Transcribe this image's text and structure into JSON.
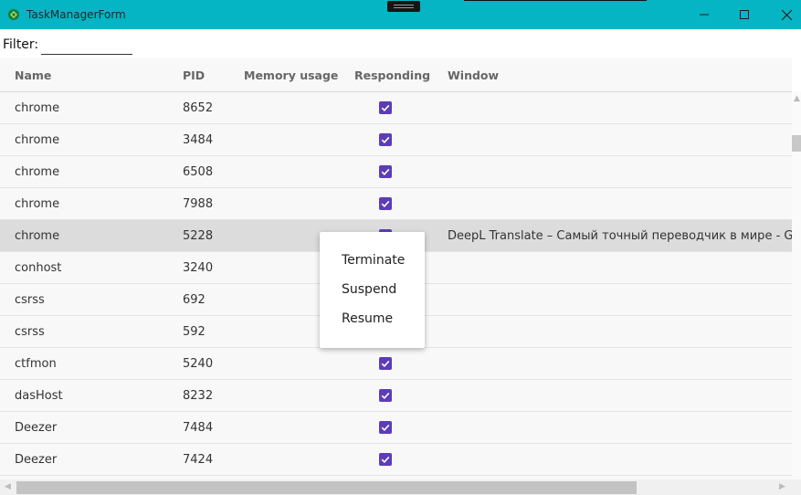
{
  "window": {
    "title": "TaskManagerForm",
    "accent": "#05b5c3",
    "icons": {
      "app": "app-icon",
      "minimize": "minimize-icon",
      "maximize": "maximize-icon",
      "close": "close-icon"
    }
  },
  "filter": {
    "label": "Filter:",
    "value": ""
  },
  "table": {
    "columns": [
      "Name",
      "PID",
      "Memory usage",
      "Responding",
      "Window"
    ],
    "rows": [
      {
        "name": "chrome",
        "pid": "8652",
        "memory": "",
        "responding": true,
        "window": ""
      },
      {
        "name": "chrome",
        "pid": "3484",
        "memory": "",
        "responding": true,
        "window": ""
      },
      {
        "name": "chrome",
        "pid": "6508",
        "memory": "",
        "responding": true,
        "window": ""
      },
      {
        "name": "chrome",
        "pid": "7988",
        "memory": "",
        "responding": true,
        "window": ""
      },
      {
        "name": "chrome",
        "pid": "5228",
        "memory": "",
        "responding": true,
        "window": "DeepL Translate – Самый точный переводчик в мире - Google C",
        "selected": true
      },
      {
        "name": "conhost",
        "pid": "3240",
        "memory": "",
        "responding": true,
        "window": ""
      },
      {
        "name": "csrss",
        "pid": "692",
        "memory": "",
        "responding": true,
        "window": ""
      },
      {
        "name": "csrss",
        "pid": "592",
        "memory": "",
        "responding": true,
        "window": ""
      },
      {
        "name": "ctfmon",
        "pid": "5240",
        "memory": "",
        "responding": true,
        "window": ""
      },
      {
        "name": "dasHost",
        "pid": "8232",
        "memory": "",
        "responding": true,
        "window": ""
      },
      {
        "name": "Deezer",
        "pid": "7484",
        "memory": "",
        "responding": true,
        "window": ""
      },
      {
        "name": "Deezer",
        "pid": "7424",
        "memory": "",
        "responding": true,
        "window": ""
      }
    ],
    "checkbox_color": "#5b3db8",
    "selected_row_color": "#dcdcdc"
  },
  "context_menu": {
    "items": [
      "Terminate",
      "Suspend",
      "Resume"
    ]
  }
}
